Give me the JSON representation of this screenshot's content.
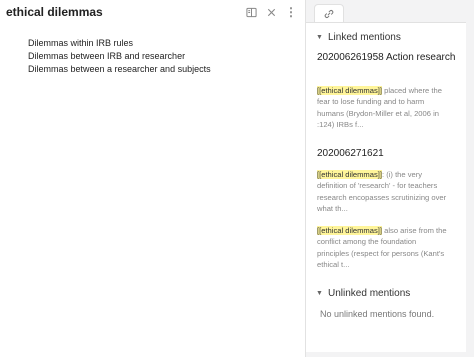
{
  "editor": {
    "title": "ethical dilemmas",
    "lines": [
      "Dilemmas within IRB rules",
      "Dilemmas between IRB and researcher",
      "Dilemmas between a researcher and subjects"
    ],
    "icons": {
      "reading_mode": "book-icon",
      "close": "close-icon",
      "more": "more-options-icon"
    }
  },
  "sidebar": {
    "tab_icon": "link-icon",
    "linked": {
      "header": "Linked mentions",
      "files": [
        {
          "name": "202006261958 Action research",
          "snippets": [
            {
              "highlight": "[[ethical dilemmas]]",
              "text": " placed where the fear to lose funding and to harm humans (Brydon-Miller et al, 2006 in :124) IRBs f..."
            }
          ]
        },
        {
          "name": "202006271621",
          "snippets": [
            {
              "highlight": "[[ethical dilemmas]]",
              "text": ": (i) the very definition of 'research' - for teachers research encopasses scrutinizing over what th..."
            },
            {
              "highlight": "[[ethical dilemmas]]",
              "text": " also arise from the conflict among the foundation principles (respect for persons (Kant's ethical t..."
            }
          ]
        }
      ]
    },
    "unlinked": {
      "header": "Unlinked mentions",
      "empty_text": "No unlinked mentions found."
    },
    "colors": {
      "highlight": "#fff59a",
      "panel_bg": "#f3f3f4"
    }
  }
}
